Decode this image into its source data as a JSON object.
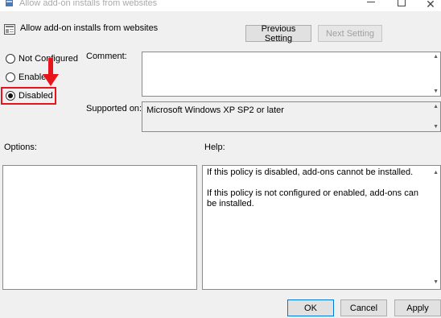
{
  "window": {
    "title": "Allow add-on installs from websites",
    "close_glyph": "✕"
  },
  "policy": {
    "title": "Allow add-on installs from websites"
  },
  "nav": {
    "previous_label": "Previous Setting",
    "next_label": "Next Setting"
  },
  "state": {
    "options": [
      {
        "label": "Not Configured",
        "checked": false
      },
      {
        "label": "Enabled",
        "checked": false
      },
      {
        "label": "Disabled",
        "checked": true
      }
    ]
  },
  "labels": {
    "comment": "Comment:",
    "supported_on": "Supported on:",
    "options": "Options:",
    "help": "Help:"
  },
  "fields": {
    "comment_value": "",
    "supported_on_value": "Microsoft Windows XP SP2 or later"
  },
  "help": {
    "paragraph1": "If this policy is disabled, add-ons cannot be installed.",
    "paragraph2": "If this policy is not configured or enabled, add-ons can be installed."
  },
  "buttons": {
    "ok": "OK",
    "cancel": "Cancel",
    "apply": "Apply"
  },
  "colors": {
    "highlight": "#e8141c",
    "window_bg": "#f0f0f0"
  },
  "icons": {
    "title": "group-policy-icon",
    "policy": "policy-setting-icon",
    "arrow": "red-arrow-annotation"
  }
}
